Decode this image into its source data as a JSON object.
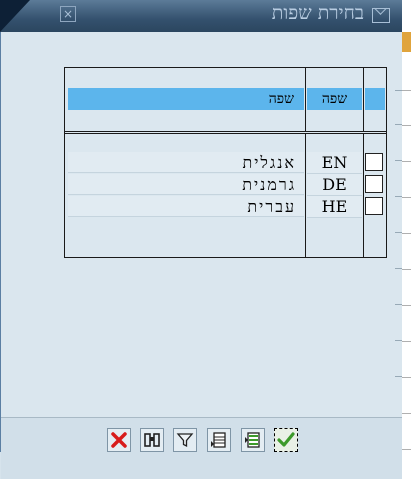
{
  "dialog": {
    "title": "בחירת שפות"
  },
  "table": {
    "headers": {
      "code": "שפה",
      "description": "שפה"
    },
    "rows": [
      {
        "code": "EN",
        "description": "אנגלית",
        "checked": false
      },
      {
        "code": "DE",
        "description": "גרמנית",
        "checked": false
      },
      {
        "code": "HE",
        "description": "עברית",
        "checked": false
      }
    ]
  },
  "toolbar": {
    "buttons": [
      {
        "name": "cancel",
        "icon": "cancel-x-icon"
      },
      {
        "name": "find",
        "icon": "binoculars-icon"
      },
      {
        "name": "filter",
        "icon": "filter-icon"
      },
      {
        "name": "select-all",
        "icon": "select-all-icon"
      },
      {
        "name": "deselect-all",
        "icon": "deselect-all-icon"
      },
      {
        "name": "confirm",
        "icon": "checkmark-icon"
      }
    ]
  },
  "colors": {
    "titlebar": "#34516e",
    "header_highlight": "#5cb5ec",
    "background": "#d6e3ec",
    "cancel_red": "#d81c1c",
    "confirm_green": "#3c9a2a"
  }
}
